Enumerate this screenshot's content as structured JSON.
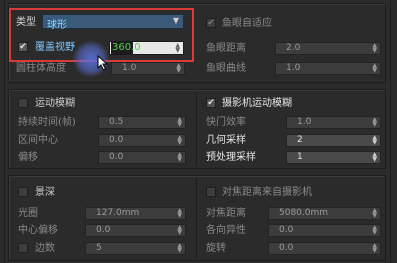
{
  "top": {
    "type_label": "类型",
    "type_value": "球形",
    "overlay_checked": "✔",
    "overlay_label": "覆盖视野",
    "overlay_value": "360.0",
    "cylinder_height_label": "圆柱体高度",
    "cylinder_height_value": "1.0",
    "fisheye_auto_checked": "✔",
    "fisheye_auto_label": "鱼眼自适应",
    "fisheye_dist_label": "鱼眼距离",
    "fisheye_dist_value": "2.0",
    "fisheye_curve_label": "鱼眼曲线",
    "fisheye_curve_value": "1.0"
  },
  "motion_blur": {
    "title": "运动模糊",
    "duration_label": "持续时间(帧)",
    "duration_value": "0.5",
    "interval_label": "区间中心",
    "interval_value": "0.0",
    "bias_label": "偏移",
    "bias_value": "0.0"
  },
  "camera_blur": {
    "checked": "✔",
    "title": "摄影机运动模糊",
    "shutter_label": "快门效率",
    "shutter_value": "1.0",
    "geo_label": "几何采样",
    "geo_value": "2",
    "prepass_label": "预处理采样",
    "prepass_value": "1"
  },
  "dof": {
    "title": "景深",
    "from_camera_label": "对焦距离来自摄影机",
    "aperture_label": "光圈",
    "aperture_value": "127.0mm",
    "center_bias_label": "中心偏移",
    "center_bias_value": "0.0",
    "sides_label": "边数",
    "sides_value": "5",
    "focus_dist_label": "对焦距离",
    "focus_dist_value": "5080.0mm",
    "anisotropy_label": "各向异性",
    "anisotropy_value": "0.0",
    "rotation_label": "旋转",
    "rotation_value": "0.0"
  },
  "colors": {
    "highlight_border": "#d93b3b",
    "cursor_glow": "#5b6fd8",
    "input_green": "#4fd14f"
  }
}
